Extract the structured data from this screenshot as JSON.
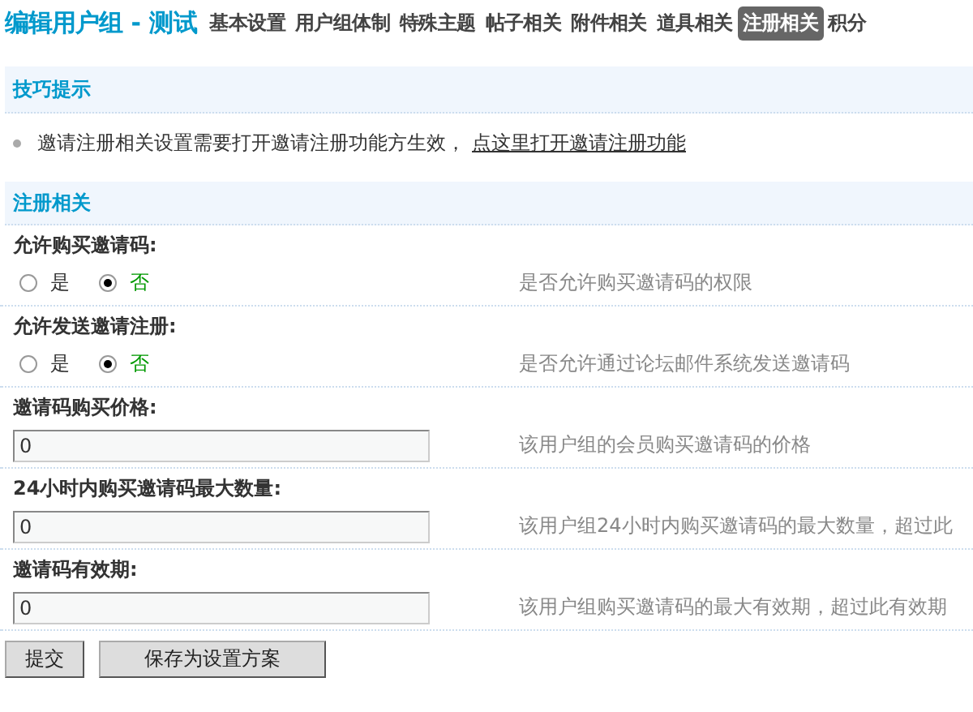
{
  "title": {
    "main": "编辑用户组",
    "sub": " - 测试"
  },
  "tabs": [
    {
      "label": "基本设置",
      "selected": false
    },
    {
      "label": "用户组体制",
      "selected": false
    },
    {
      "label": "特殊主题",
      "selected": false
    },
    {
      "label": "帖子相关",
      "selected": false
    },
    {
      "label": "附件相关",
      "selected": false
    },
    {
      "label": "道具相关",
      "selected": false
    },
    {
      "label": "注册相关",
      "selected": true
    },
    {
      "label": "积分",
      "selected": false
    }
  ],
  "tips": {
    "heading": "技巧提示",
    "items": [
      {
        "text": "邀请注册相关设置需要打开邀请注册功能方生效，",
        "link": "点这里打开邀请注册功能"
      }
    ]
  },
  "section": {
    "heading": "注册相关"
  },
  "settings": [
    {
      "kind": "radio",
      "label": "允许购买邀请码:",
      "options": [
        {
          "label": "是",
          "selected": false
        },
        {
          "label": "否",
          "selected": true
        }
      ],
      "hint": "是否允许购买邀请码的权限"
    },
    {
      "kind": "radio",
      "label": "允许发送邀请注册:",
      "options": [
        {
          "label": "是",
          "selected": false
        },
        {
          "label": "否",
          "selected": true
        }
      ],
      "hint": "是否允许通过论坛邮件系统发送邀请码"
    },
    {
      "kind": "input",
      "label": "邀请码购买价格:",
      "value": "0",
      "hint": "该用户组的会员购买邀请码的价格"
    },
    {
      "kind": "input",
      "label": "24小时内购买邀请码最大数量:",
      "value": "0",
      "hint": "该用户组24小时内购买邀请码的最大数量，超过此"
    },
    {
      "kind": "input",
      "label": "邀请码有效期:",
      "value": "0",
      "hint": "该用户组购买邀请码的最大有效期，超过此有效期"
    }
  ],
  "buttons": [
    "提交",
    "保存为设置方案"
  ]
}
